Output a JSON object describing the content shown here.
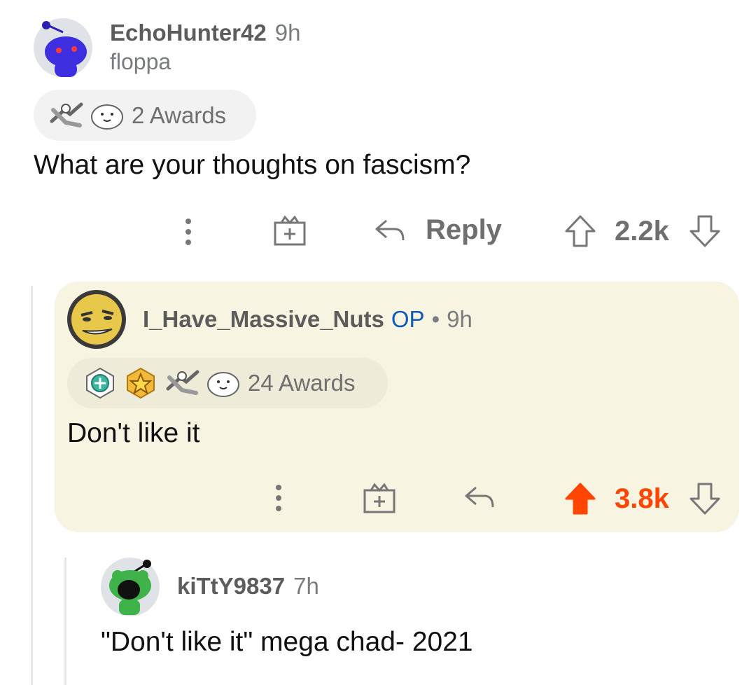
{
  "comments": [
    {
      "username": "EchoHunter42",
      "age": "9h",
      "flair": "floppa",
      "awards_label": "2 Awards",
      "body": "What are your thoughts on fascism?",
      "reply_label": "Reply",
      "score": "2.2k",
      "voted": "none"
    },
    {
      "username": "I_Have_Massive_Nuts",
      "op_badge": "OP",
      "separator": "•",
      "age": "9h",
      "awards_label": "24 Awards",
      "body": "Don't like it",
      "score": "3.8k",
      "voted": "up",
      "highlighted": true
    },
    {
      "username": "kiTtY9837",
      "age": "7h",
      "body": "\"Don't like it\" mega chad- 2021"
    }
  ],
  "colors": {
    "upvote_active": "#ff4500",
    "op_blue": "#0f5bb5",
    "highlight_bg": "#f8f4e2",
    "avatar_blue": "#3d2ee0"
  },
  "icons": [
    "snoo-avatar",
    "wojak-avatar",
    "frog-snoo-avatar",
    "handshake-award-icon",
    "seal-award-icon",
    "helper-award-icon",
    "gold-star-award-icon",
    "more-options-icon",
    "gift-award-icon",
    "reply-arrow-icon",
    "upvote-icon",
    "downvote-icon"
  ]
}
